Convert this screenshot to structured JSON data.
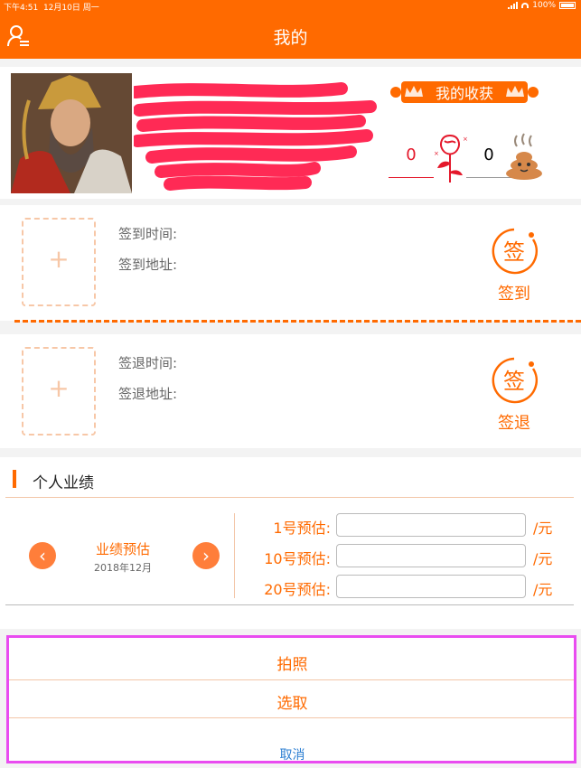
{
  "status_bar": {
    "time": "下午4:51",
    "date": "12月10日 周一",
    "battery": "100%"
  },
  "nav": {
    "title": "我的",
    "left_icon": "user-switch-icon"
  },
  "profile": {
    "harvest_label": "我的收获",
    "rose_count": "0",
    "poop_count": "0"
  },
  "check_in": {
    "time_label": "签到时间:",
    "address_label": "签到地址:",
    "button_glyph": "签",
    "button_label": "签到",
    "add_photo_glyph": "+"
  },
  "check_out": {
    "time_label": "签退时间:",
    "address_label": "签退地址:",
    "button_glyph": "签",
    "button_label": "签退",
    "add_photo_glyph": "+"
  },
  "performance": {
    "title": "个人业绩",
    "estimate_label": "业绩预估",
    "month": "2018年12月",
    "prev_glyph": "‹",
    "next_glyph": "›",
    "rows": [
      {
        "label": "1号预估:",
        "value": "",
        "unit": "/元"
      },
      {
        "label": "10号预估:",
        "value": "",
        "unit": "/元"
      },
      {
        "label": "20号预估:",
        "value": "",
        "unit": "/元"
      }
    ]
  },
  "action_sheet": {
    "items": [
      "拍照",
      "选取"
    ],
    "cancel": "取消"
  },
  "colors": {
    "accent": "#ff6a00",
    "rose": "#e4182b",
    "cancel": "#2d7fd2",
    "highlight": "#e94cf0"
  }
}
